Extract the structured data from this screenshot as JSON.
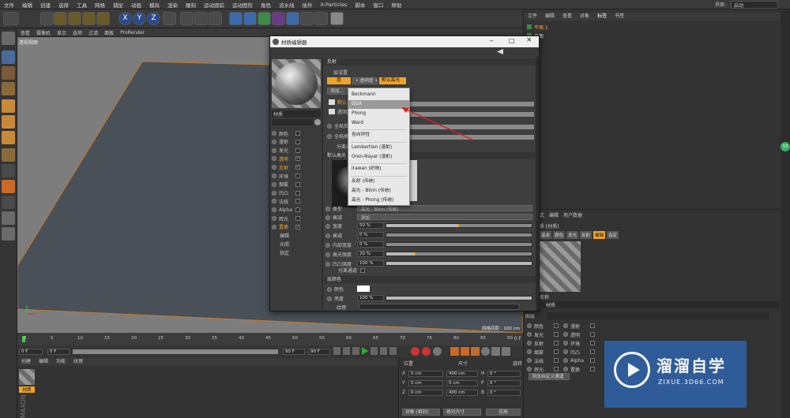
{
  "menubar": {
    "items": [
      "文件",
      "编辑",
      "创建",
      "选择",
      "工具",
      "网格",
      "捕捉",
      "动画",
      "模拟",
      "渲染",
      "雕刻",
      "运动跟踪",
      "运动图形",
      "角色",
      "流水线",
      "插件",
      "X-Particles",
      "脚本",
      "窗口",
      "帮助"
    ],
    "right_label": "界面:",
    "right_value": "启动"
  },
  "viewport": {
    "menu": [
      "查看",
      "摄像机",
      "显示",
      "选项",
      "过滤",
      "面板",
      "ProRender"
    ],
    "label": "透视视图",
    "grid_info": "网格间距 : 100 cm"
  },
  "timeline": {
    "ticks": [
      "0",
      "5",
      "10",
      "15",
      "20",
      "25",
      "30",
      "35",
      "40",
      "45",
      "50",
      "55",
      "60",
      "65",
      "70",
      "75",
      "80",
      "85",
      "90"
    ],
    "end_label": "0 F",
    "start_field": "0 F",
    "start2_field": "0 F",
    "end_field": "90 F",
    "end2_field": "90 F"
  },
  "material_manager": {
    "menu": [
      "创建",
      "编辑",
      "功能",
      "纹理"
    ],
    "material_name": "材质"
  },
  "coords": {
    "headers": [
      "位置",
      "尺寸",
      "旋转"
    ],
    "rows": [
      {
        "axis": "X",
        "pos": "0 cm",
        "size": "400 cm",
        "rot_axis": "H",
        "rot": "0 °"
      },
      {
        "axis": "Y",
        "pos": "0 cm",
        "size": "0 cm",
        "rot_axis": "P",
        "rot": "0 °"
      },
      {
        "axis": "Z",
        "pos": "0 cm",
        "size": "400 cm",
        "rot_axis": "B",
        "rot": "0 °"
      }
    ],
    "mode1": "对象 (相对)",
    "mode2": "绝对尺寸",
    "apply": "应用"
  },
  "objects": {
    "tabs": [
      "文件",
      "编辑",
      "查看",
      "对象",
      "标签",
      "书签"
    ],
    "items": [
      "平面.1",
      "平面"
    ]
  },
  "attributes": {
    "tabs": [
      "模式",
      "编辑",
      "用户数据"
    ],
    "title": "质 [材质]",
    "subtabs": [
      "基本",
      "颜色",
      "发光",
      "反射",
      "编辑",
      "指定"
    ],
    "name_label": "名称",
    "name_value": "材质",
    "layer_label": "图层",
    "channels": [
      [
        "颜色",
        "漫射"
      ],
      [
        "发光",
        "透明"
      ],
      [
        "反射",
        "环境"
      ],
      [
        "烟雾",
        "凹凸"
      ],
      [
        "法线",
        "Alpha"
      ],
      [
        "辉光",
        "置换"
      ]
    ],
    "bottom_btn": "添加自定义通道",
    "badge": "53"
  },
  "dialog": {
    "title": "材质编辑器",
    "mat_name": "材质",
    "section": "反射",
    "layer_label": "层设置",
    "layer_btn1": "层",
    "layer_btn2": "• 透明度 •",
    "layer_btn3": "默认高光",
    "add_btn": "添加...",
    "layer_row1": "默认",
    "layer_row2": "透明度",
    "global_refl": "全局反射",
    "global_spec": "全局高光",
    "separate": "分离通道",
    "default_spec": "默认高光",
    "channels": [
      "颜色",
      "漫射",
      "发光",
      "透明",
      "反射",
      "环境",
      "烟雾",
      "凹凸",
      "法线",
      "Alpha",
      "辉光",
      "置换",
      "编辑",
      "光照",
      "指定"
    ],
    "checked": [
      "透明",
      "反射",
      "置换"
    ],
    "props": [
      {
        "label": "类型",
        "value": "高光 - Blinn (传统)"
      },
      {
        "label": "衰减",
        "value": "添加"
      },
      {
        "label": "宽度",
        "value": "50 %",
        "fill": 0.5
      },
      {
        "label": "衰减",
        "value": "0 %",
        "fill": 0
      },
      {
        "label": "内部宽度",
        "value": "0 %",
        "fill": 0
      },
      {
        "label": "高光强度",
        "value": "20 %",
        "fill": 0.2
      },
      {
        "label": "凹凸强度",
        "value": "100 %",
        "fill": 1
      }
    ],
    "sep_pass": "分离通道",
    "layer_color": "层颜色",
    "color_label": "颜色",
    "bright_label": "亮度",
    "bright_value": "100 %",
    "tex_label": "纹理"
  },
  "dropdown": {
    "items": [
      "Beckmann",
      "GGX",
      "Phong",
      "Ward",
      "各向异性",
      "Lambertian (漫射)",
      "Oren-Nayar (漫射)",
      "Irawan (织物)",
      "反射 (传统)",
      "高光 - Blinn (传统)",
      "高光 - Phong (传统)"
    ],
    "selected": "GGX"
  },
  "watermark": {
    "brand": "溜溜自学",
    "url": "ZIXUE.3D66.COM"
  },
  "colors": {
    "accent": "#f0a22a",
    "arrow": "#d42020"
  }
}
